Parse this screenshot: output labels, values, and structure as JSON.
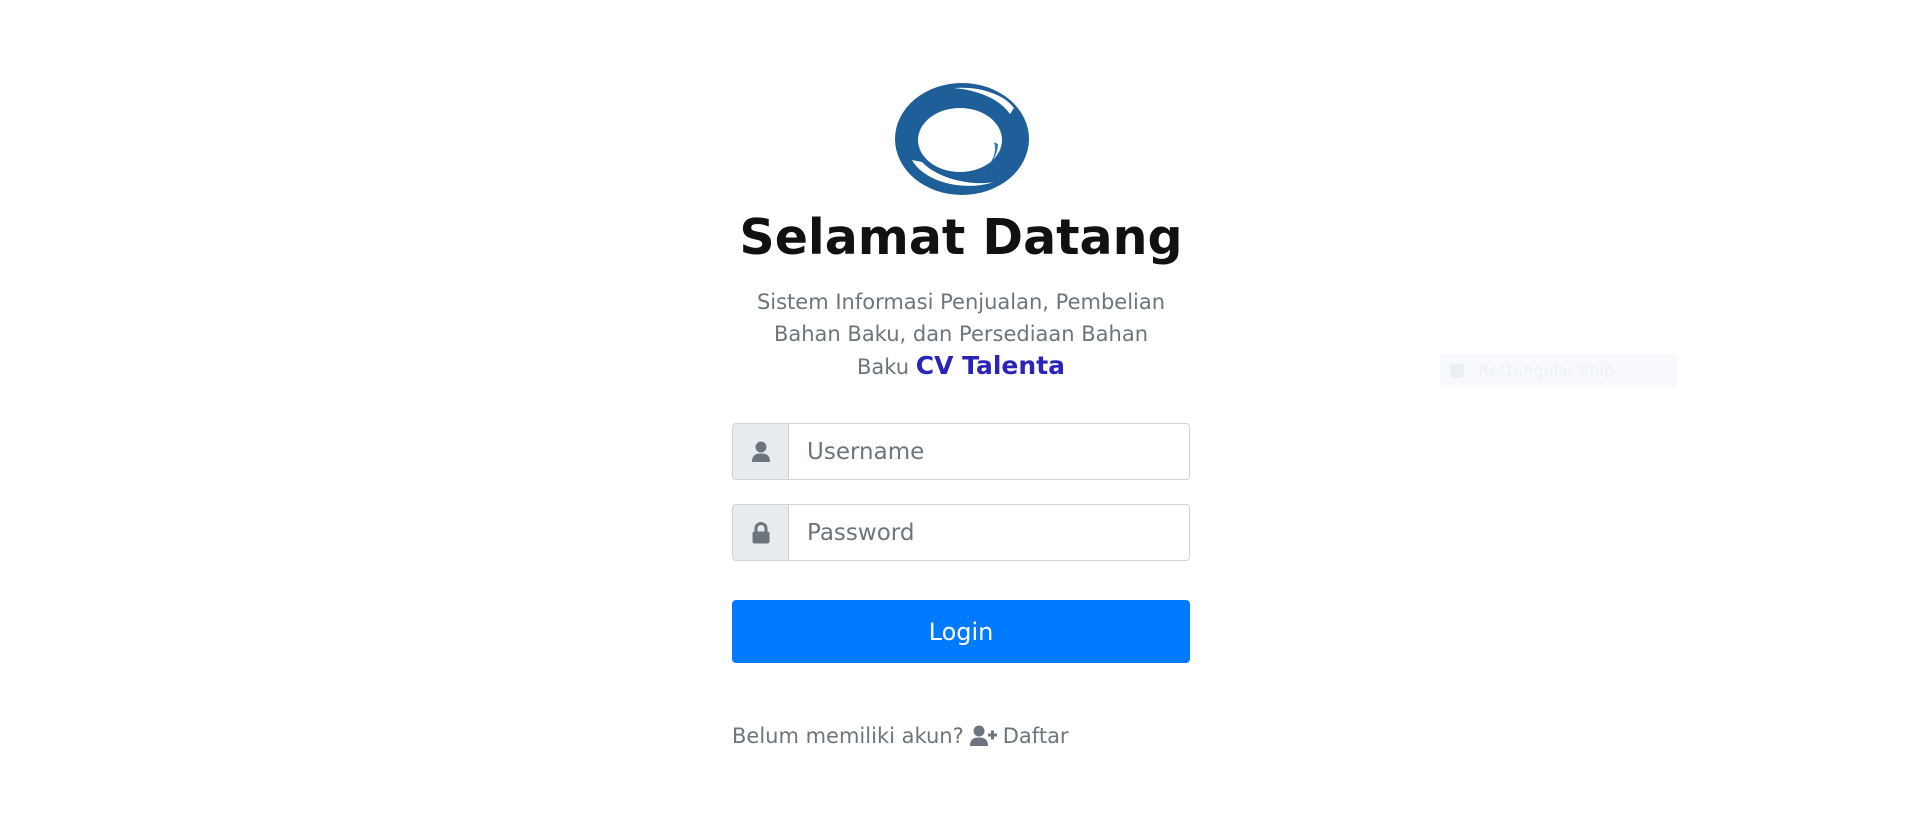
{
  "header": {
    "logo": "company-logo",
    "title": "Selamat Datang",
    "subtitle_line1": "Sistem Informasi Penjualan, Pembelian",
    "subtitle_line2": "Bahan Baku, dan Persediaan Bahan",
    "subtitle_line3": "Baku",
    "brand": "CV Talenta"
  },
  "form": {
    "username": {
      "placeholder": "Username",
      "value": "",
      "icon": "user-icon"
    },
    "password": {
      "placeholder": "Password",
      "value": "",
      "icon": "lock-icon"
    },
    "login_label": "Login"
  },
  "footer": {
    "prompt": "Belum memiliki akun?",
    "register_label": "Daftar",
    "register_icon": "user-plus-icon"
  },
  "overlay": {
    "label": "Rectangular Snip"
  },
  "colors": {
    "primary": "#007bff",
    "brand": "#2a24b8",
    "muted": "#6c757d",
    "logo": "#1e5f99"
  }
}
